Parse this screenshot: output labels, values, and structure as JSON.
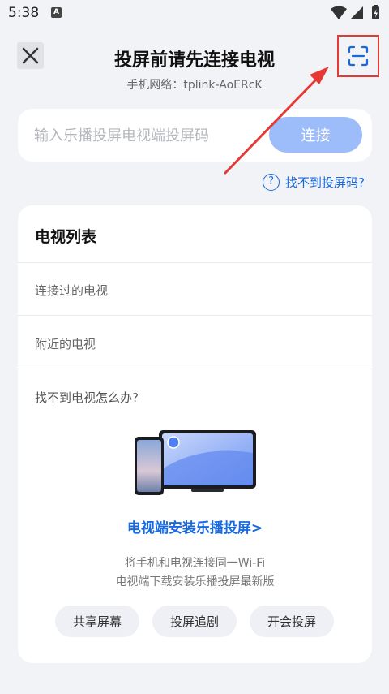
{
  "status_bar": {
    "time": "5:38",
    "badge": "A",
    "icons": [
      "wifi-icon",
      "signal-icon",
      "battery-icon"
    ]
  },
  "header": {
    "title": "投屏前请先连接电视",
    "network_text": "手机网络：tplink-AoERcK",
    "close_icon": "close-icon",
    "scan_icon": "scan-icon"
  },
  "code_input": {
    "placeholder": "输入乐播投屏电视端投屏码",
    "value": "",
    "connect_label": "连接"
  },
  "help": {
    "label": "找不到投屏码?",
    "icon": "question-circle-icon"
  },
  "tv_list": {
    "title": "电视列表",
    "connected_label": "连接过的电视",
    "nearby_label": "附近的电视",
    "tip_title": "找不到电视怎么办?",
    "install_link": "电视端安装乐播投屏>",
    "desc_line1": "将手机和电视连接同一Wi-Fi",
    "desc_line2": "电视端下载安装乐播投屏最新版",
    "actions": [
      "共享屏幕",
      "投屏追剧",
      "开会投屏"
    ]
  },
  "colors": {
    "accent": "#1769e0",
    "button_disabled": "#9dbdfa",
    "annotation_red": "#e53935",
    "background": "#f2f3f7"
  }
}
